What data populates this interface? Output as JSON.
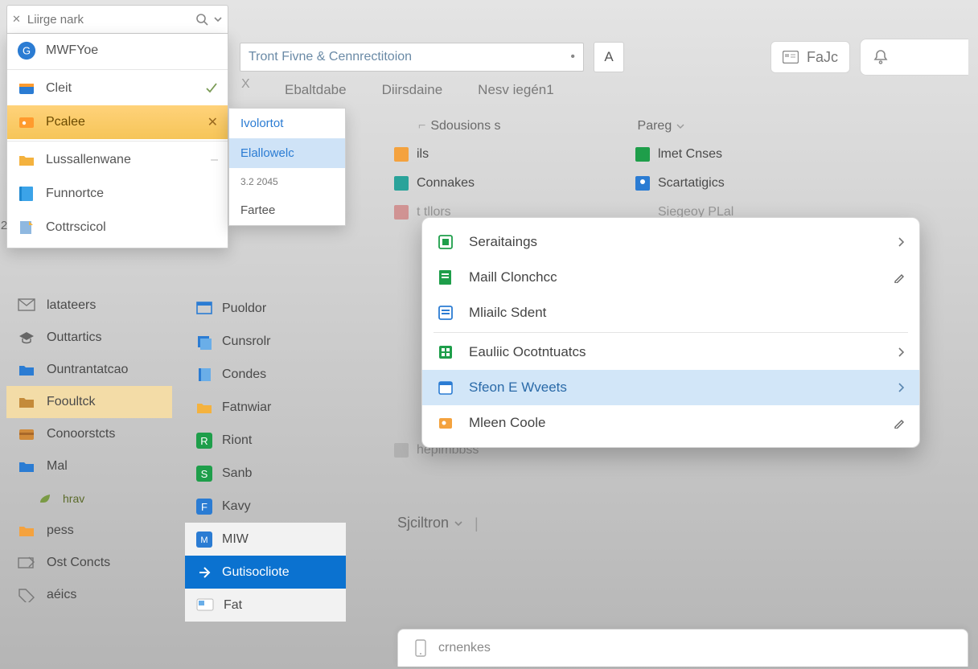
{
  "search": {
    "placeholder": "Liirge nark"
  },
  "sidebar_top": [
    {
      "icon": "globe",
      "label": "MWFYoe",
      "trail": ""
    },
    {
      "icon": "card-blue",
      "label": "Cleit",
      "trail": "check"
    },
    {
      "icon": "card-orange",
      "label": "Pcalee",
      "trail": "close",
      "orange": true
    },
    {
      "icon": "folder",
      "label": "Lussallenwane",
      "trail": ""
    },
    {
      "icon": "book",
      "label": "Funnortce",
      "trail": ""
    },
    {
      "icon": "note",
      "label": "Cottrscicol",
      "trail": ""
    }
  ],
  "sidebar_badge": "2",
  "drop1": {
    "items": [
      {
        "label": "Ivolortot",
        "sel": false
      },
      {
        "label": "Elallowelc",
        "sel": true
      },
      {
        "label": "3.2 2045",
        "small": true
      },
      {
        "label": "Fartee",
        "plain": true
      }
    ]
  },
  "topbar": {
    "address": "Tront Fivne & Cennrectitoion",
    "sq_label": "A",
    "faic": "FaJc",
    "tabs": [
      "Ebaltdabe",
      "Diirsdaine",
      "Nesv iegén1"
    ]
  },
  "content": {
    "headers": [
      "Sdousions s",
      "Pareg"
    ],
    "col1": [
      {
        "icon": "sq-orange",
        "label": "ils"
      },
      {
        "icon": "sq-teal",
        "label": "Connakes"
      },
      {
        "icon": "sq-red",
        "label": "t   tllors",
        "fade": true
      },
      {
        "icon": "sq-gray",
        "label": "hepimbbss",
        "fade": true
      }
    ],
    "col2": [
      {
        "icon": "sq-green",
        "label": "lmet Cnses"
      },
      {
        "icon": "person",
        "label": "Scartatigics"
      },
      {
        "icon": "none",
        "label": "Siegeoy PLal",
        "fade": true
      }
    ]
  },
  "popup": [
    {
      "icon": "sq-green-outline",
      "label": "Seraitaings",
      "end": "chevron"
    },
    {
      "icon": "sq-green-doc",
      "label": "Maill Clonchcc",
      "end": "pen"
    },
    {
      "icon": "sq-blue-doc",
      "label": "Mliailc Sdent",
      "end": "",
      "sep_after": true
    },
    {
      "icon": "sq-green-grid",
      "label": "Eauliic Ocotntuatcs",
      "end": "chevron"
    },
    {
      "icon": "sq-blue-cal",
      "label": "Sfeon E Wveets",
      "end": "chevron",
      "sel": true
    },
    {
      "icon": "sq-orange-person",
      "label": "Mleen Coole",
      "end": "pen"
    }
  ],
  "lower_list": [
    {
      "icon": "mail",
      "label": "latateers"
    },
    {
      "icon": "hat",
      "label": "Outtartics"
    },
    {
      "icon": "folder-blue",
      "label": "Ountrantatcao"
    },
    {
      "icon": "folder-tan",
      "label": "Fooultck",
      "yellow": true
    },
    {
      "icon": "wallet",
      "label": "Conoorstcts"
    },
    {
      "icon": "folder-blue2",
      "label": "Mal"
    },
    {
      "icon": "leaf",
      "label": "hrav",
      "indent": true
    },
    {
      "icon": "folder-orange",
      "label": "pess"
    },
    {
      "icon": "envelope-out",
      "label": "Ost Concts"
    },
    {
      "icon": "tag",
      "label": "aéics"
    }
  ],
  "col2_list": [
    {
      "icon": "win-blue",
      "label": "Puoldor"
    },
    {
      "icon": "stack-blue",
      "label": "Cunsrolr"
    },
    {
      "icon": "book-blue",
      "label": "Condes"
    },
    {
      "icon": "folder-yellow",
      "label": "Fatnwiar"
    },
    {
      "icon": "sq-green-r",
      "label": "Riont"
    },
    {
      "icon": "sq-green-s",
      "label": "Sanb"
    },
    {
      "icon": "sq-blue-f",
      "label": "Kavy"
    },
    {
      "icon": "sq-blue-m",
      "label": "MIW",
      "muted": true
    },
    {
      "icon": "arrow-blue",
      "label": "Gutisocliote",
      "blue_sel": true
    },
    {
      "icon": "card-photo",
      "label": "Fat",
      "muted": true
    }
  ],
  "section_dd": {
    "label": "Sjciltron"
  },
  "bottom": {
    "label": "crnenkes"
  },
  "close_x": "X"
}
